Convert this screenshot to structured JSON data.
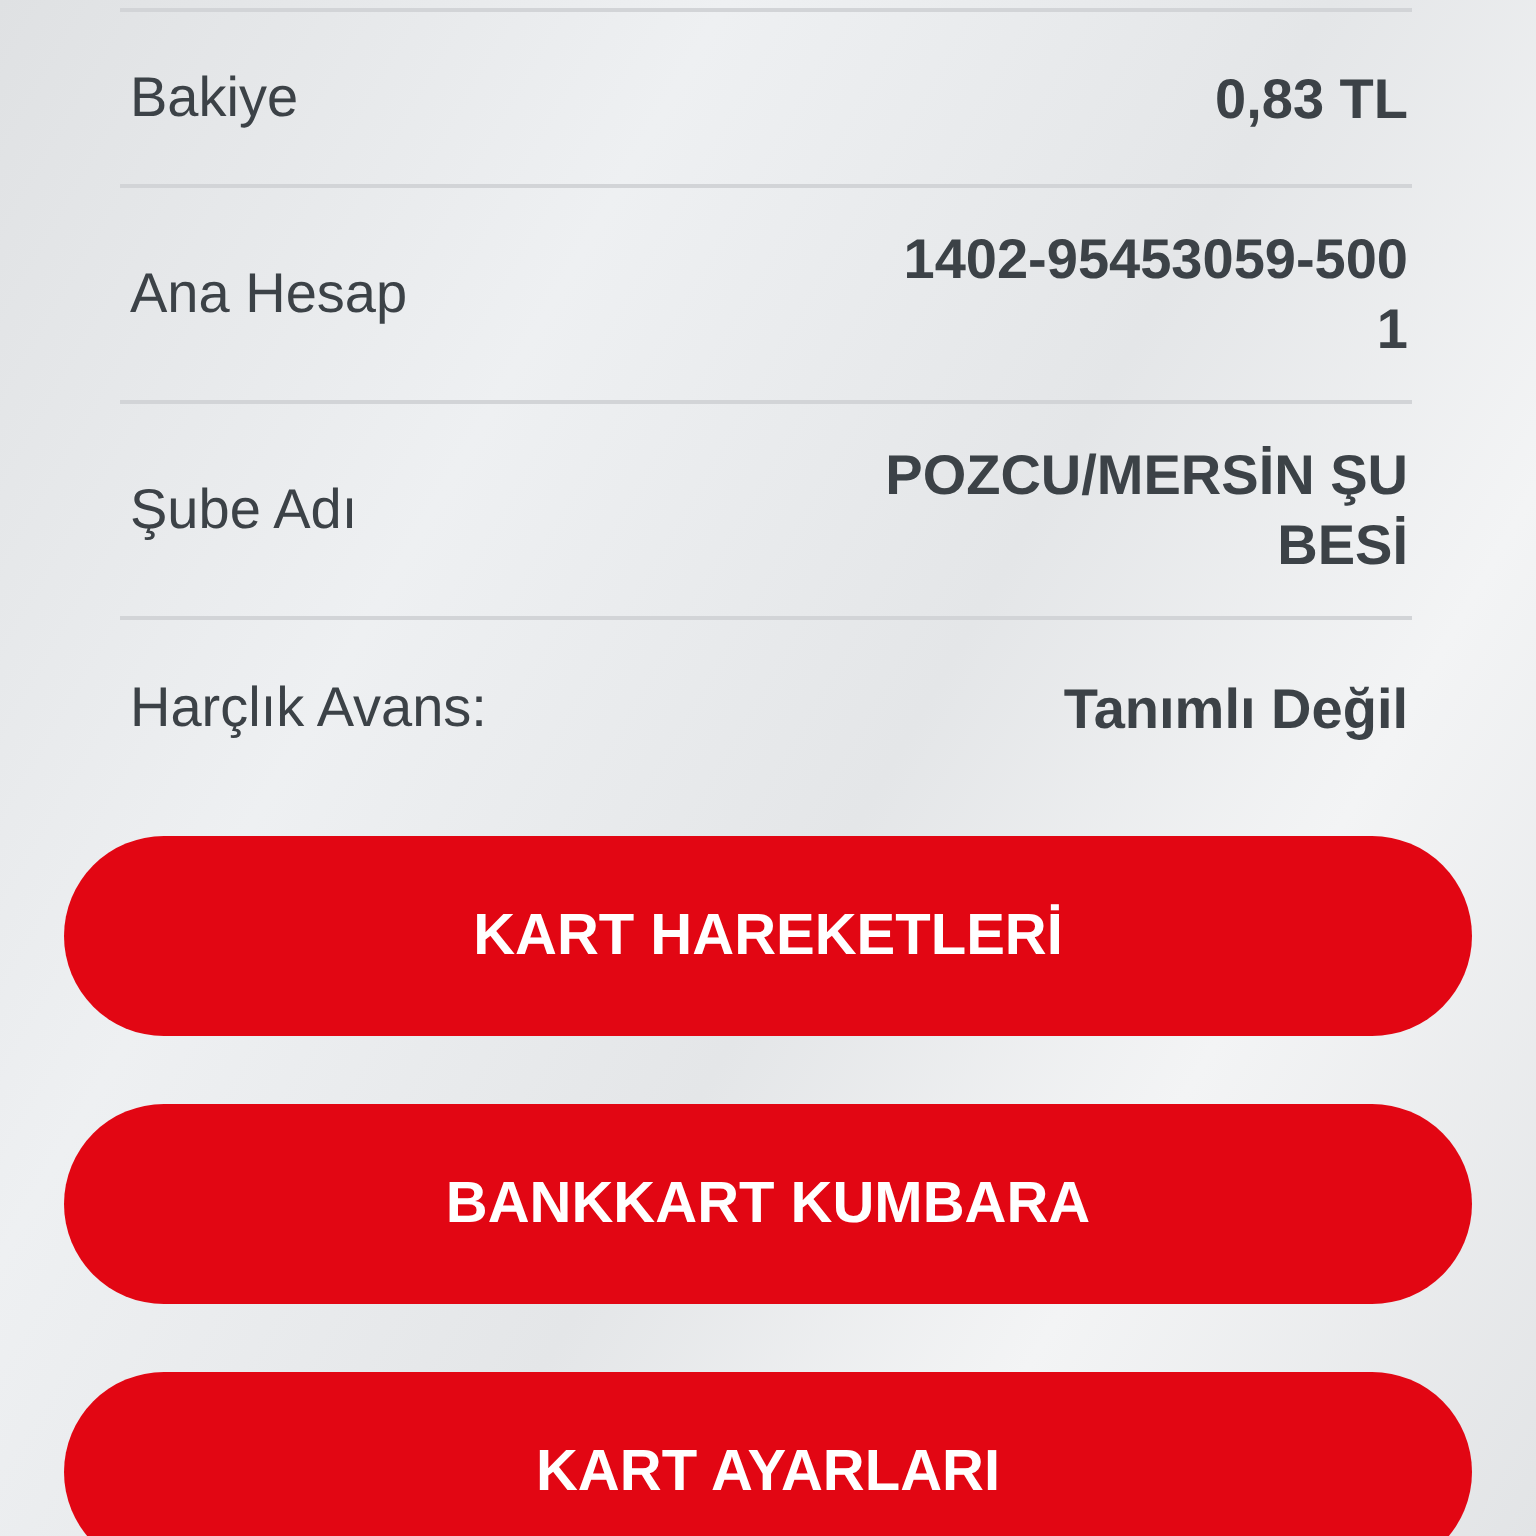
{
  "details": [
    {
      "label": "Bakiye",
      "value": "0,83 TL"
    },
    {
      "label": "Ana Hesap",
      "value": "1402-95453059-5001"
    },
    {
      "label": "Şube Adı",
      "value": "POZCU/MERSİN ŞUBESİ"
    },
    {
      "label": "Harçlık Avans:",
      "value": "Tanımlı Değil"
    }
  ],
  "buttons": [
    "KART HAREKETLERİ",
    "BANKKART KUMBARA",
    "KART AYARLARI"
  ]
}
